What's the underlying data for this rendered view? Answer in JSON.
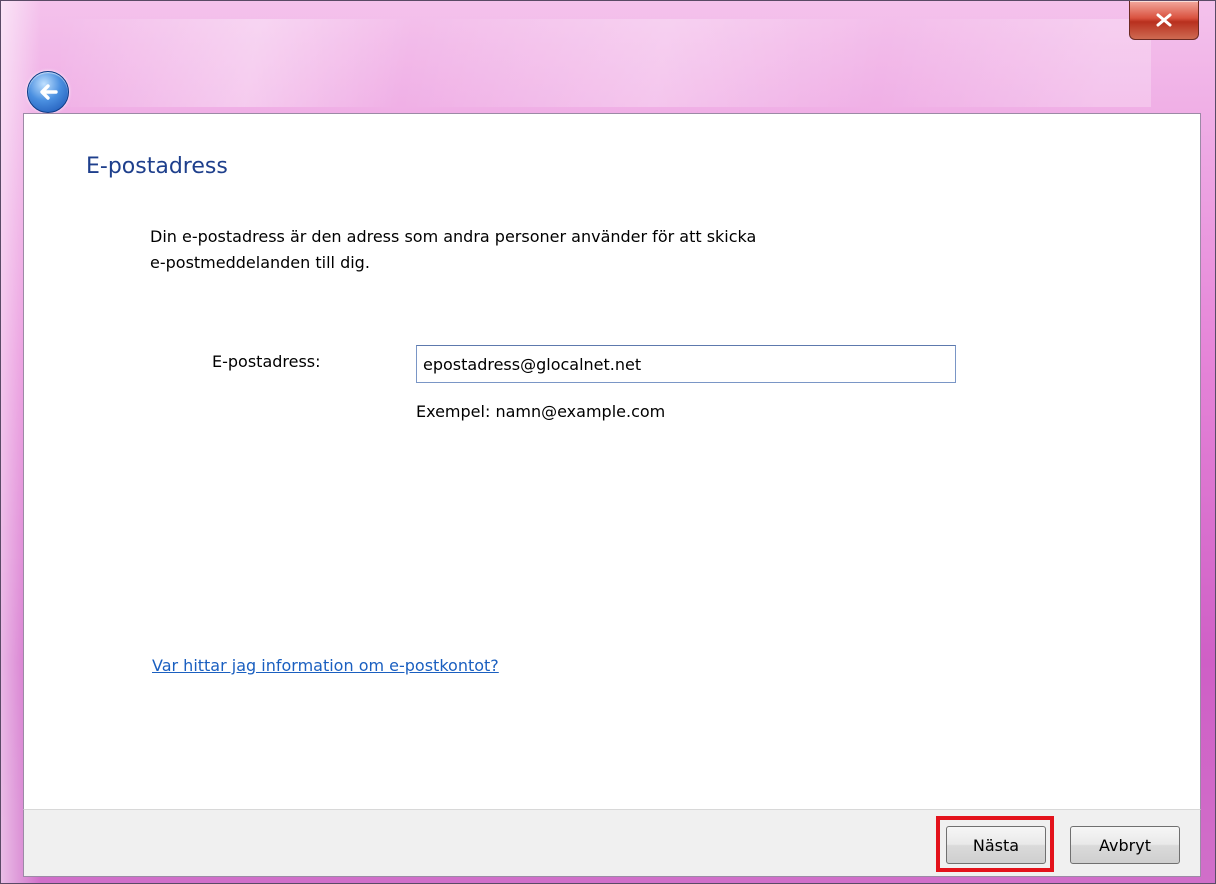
{
  "window": {
    "close_icon": "close-icon",
    "back_icon": "back-arrow-icon"
  },
  "page": {
    "heading": "E-postadress",
    "description_line1": "Din e-postadress är den adress som andra personer använder för att skicka",
    "description_line2": "e-postmeddelanden till dig.",
    "email_label": "E-postadress:",
    "email_value": "epostadress@glocalnet.net",
    "example_text": "Exempel: namn@example.com",
    "help_link": "Var hittar jag information om e-postkontot?"
  },
  "footer": {
    "next_label": "Nästa",
    "cancel_label": "Avbryt",
    "highlight_color": "#e3121b"
  }
}
